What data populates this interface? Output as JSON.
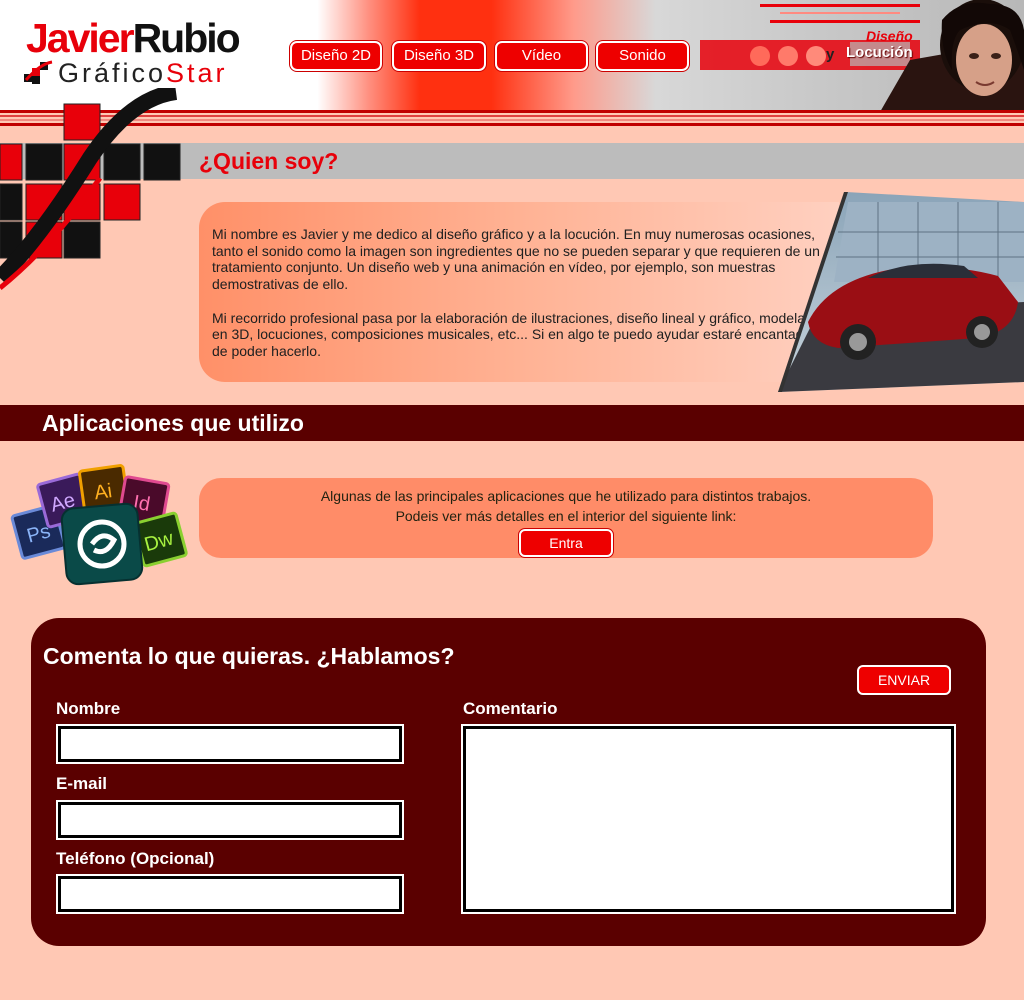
{
  "header": {
    "logo_first": "Javier",
    "logo_last": "Rubio",
    "logo_sub_1": "Gráfico",
    "logo_sub_2": "Star",
    "nav": [
      "Diseño 2D",
      "Diseño 3D",
      "Vídeo",
      "Sonido"
    ],
    "slogan_1": "Diseño",
    "slogan_y": "y",
    "slogan_2": "Locución"
  },
  "about": {
    "title": "¿Quien soy?",
    "paragraph_1": "Mi nombre es Javier y me dedico al diseño gráfico y a la locución. En muy numerosas ocasiones, tanto el sonido como la imagen son ingredientes que no se pueden separar y que requieren de un tratamiento conjunto. Un diseño web y una animación en vídeo, por ejemplo, son muestras demostrativas de ello.",
    "paragraph_2": "Mi recorrido profesional pasa por la elaboración de ilustraciones, diseño lineal y gráfico, modelado en 3D, locuciones, composiciones musicales, etc... Si en algo te puedo ayudar estaré encantado de poder hacerlo."
  },
  "apps": {
    "title": "Aplicaciones que utilizo",
    "line_1": "Algunas de las principales aplicaciones que he utilizado para distintos trabajos.",
    "line_2": "Podeis ver más detalles en el interior del siguiente link:",
    "button": "Entra",
    "icon_labels": [
      "Ps",
      "Ae",
      "Ai",
      "Id",
      "Dw"
    ]
  },
  "contact": {
    "title": "Comenta lo que quieras. ¿Hablamos?",
    "submit": "ENVIAR",
    "name_label": "Nombre",
    "email_label": "E-mail",
    "phone_label": "Teléfono (Opcional)",
    "comment_label": "Comentario",
    "name_value": "",
    "email_value": "",
    "phone_value": "",
    "comment_value": ""
  },
  "colors": {
    "accent_red": "#ee0000",
    "dark_maroon": "#5a0000",
    "page_bg": "#ffc8b4"
  }
}
